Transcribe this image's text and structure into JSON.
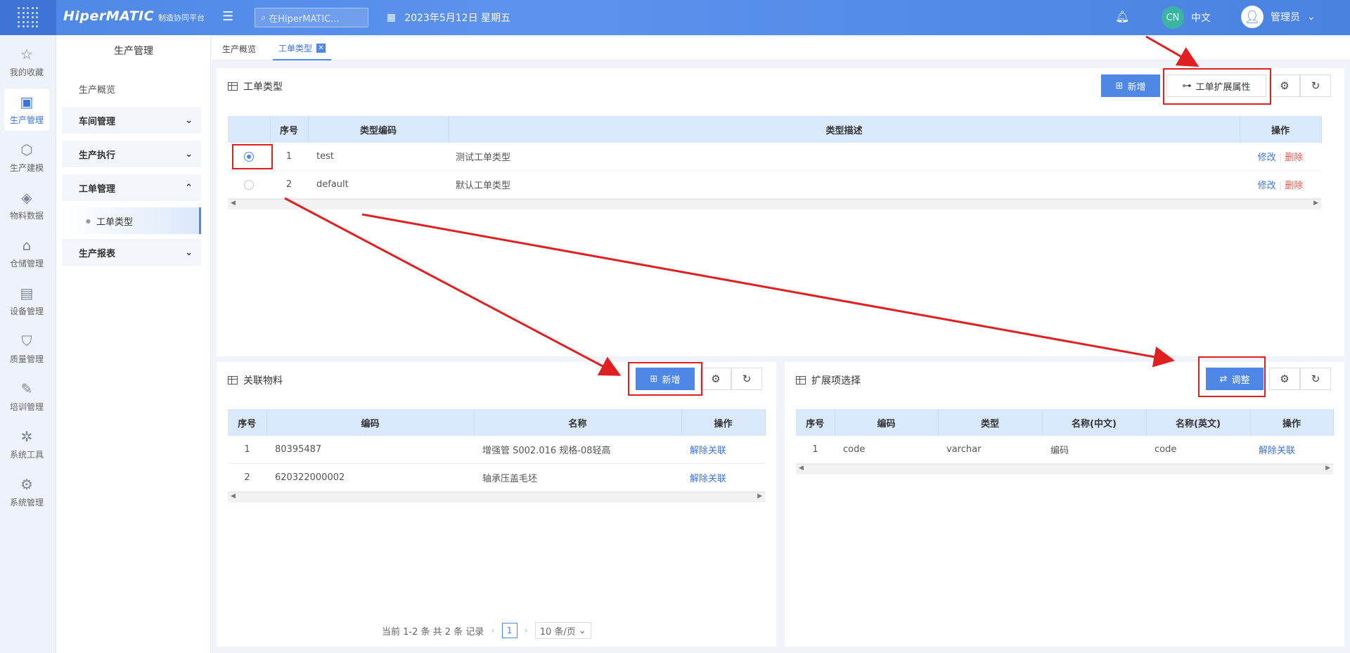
{
  "topbar": {
    "brand": "HiperMATIC",
    "brand_sub": "制造协同平台",
    "search_placeholder": "在HiperMATIC...",
    "date": "2023年5月12日 星期五",
    "lang_badge": "CN",
    "lang_label": "中文",
    "user_name": "管理员"
  },
  "leftnav": [
    {
      "label": "我的收藏",
      "icon": "star-icon"
    },
    {
      "label": "生产管理",
      "icon": "production-icon"
    },
    {
      "label": "生产建模",
      "icon": "cube-icon"
    },
    {
      "label": "物料数据",
      "icon": "material-icon"
    },
    {
      "label": "仓储管理",
      "icon": "warehouse-icon"
    },
    {
      "label": "设备管理",
      "icon": "device-icon"
    },
    {
      "label": "质量管理",
      "icon": "shield-icon"
    },
    {
      "label": "培训管理",
      "icon": "training-icon"
    },
    {
      "label": "系统工具",
      "icon": "network-icon"
    },
    {
      "label": "系统管理",
      "icon": "settings-icon"
    }
  ],
  "subnav": {
    "title": "生产管理",
    "items": [
      "生产概览",
      "车间管理",
      "生产执行",
      "工单管理",
      "工单类型",
      "生产报表"
    ]
  },
  "tabs": [
    "生产概览",
    "工单类型"
  ],
  "top_panel": {
    "title": "工单类型",
    "add_label": "新增",
    "ext_label": "工单扩展属性",
    "columns": [
      "序号",
      "类型编码",
      "类型描述",
      "操作"
    ],
    "rows": [
      {
        "no": "1",
        "code": "test",
        "desc": "测试工单类型",
        "edit": "修改",
        "del": "删除"
      },
      {
        "no": "2",
        "code": "default",
        "desc": "默认工单类型",
        "edit": "修改",
        "del": "删除"
      }
    ]
  },
  "material_panel": {
    "title": "关联物料",
    "add_label": "新增",
    "columns": [
      "序号",
      "编码",
      "名称",
      "操作"
    ],
    "rows": [
      {
        "no": "1",
        "code": "80395487",
        "name": "增强管 S002.016 规格-08轻高",
        "op": "解除关联"
      },
      {
        "no": "2",
        "code": "620322000002",
        "name": "轴承压盖毛坯",
        "op": "解除关联"
      }
    ],
    "pager": {
      "summary": "当前 1-2 条 共 2 条 记录",
      "page": "1",
      "size": "10 条/页"
    }
  },
  "ext_panel": {
    "title": "扩展项选择",
    "adjust_label": "调整",
    "columns": [
      "序号",
      "编码",
      "类型",
      "名称(中文)",
      "名称(英文)",
      "操作"
    ],
    "rows": [
      {
        "no": "1",
        "code": "code",
        "type": "varchar",
        "name_cn": "编码",
        "name_en": "code",
        "op": "解除关联"
      }
    ]
  },
  "colors": {
    "primary": "#4f87e6",
    "annotation": "#e02020"
  }
}
